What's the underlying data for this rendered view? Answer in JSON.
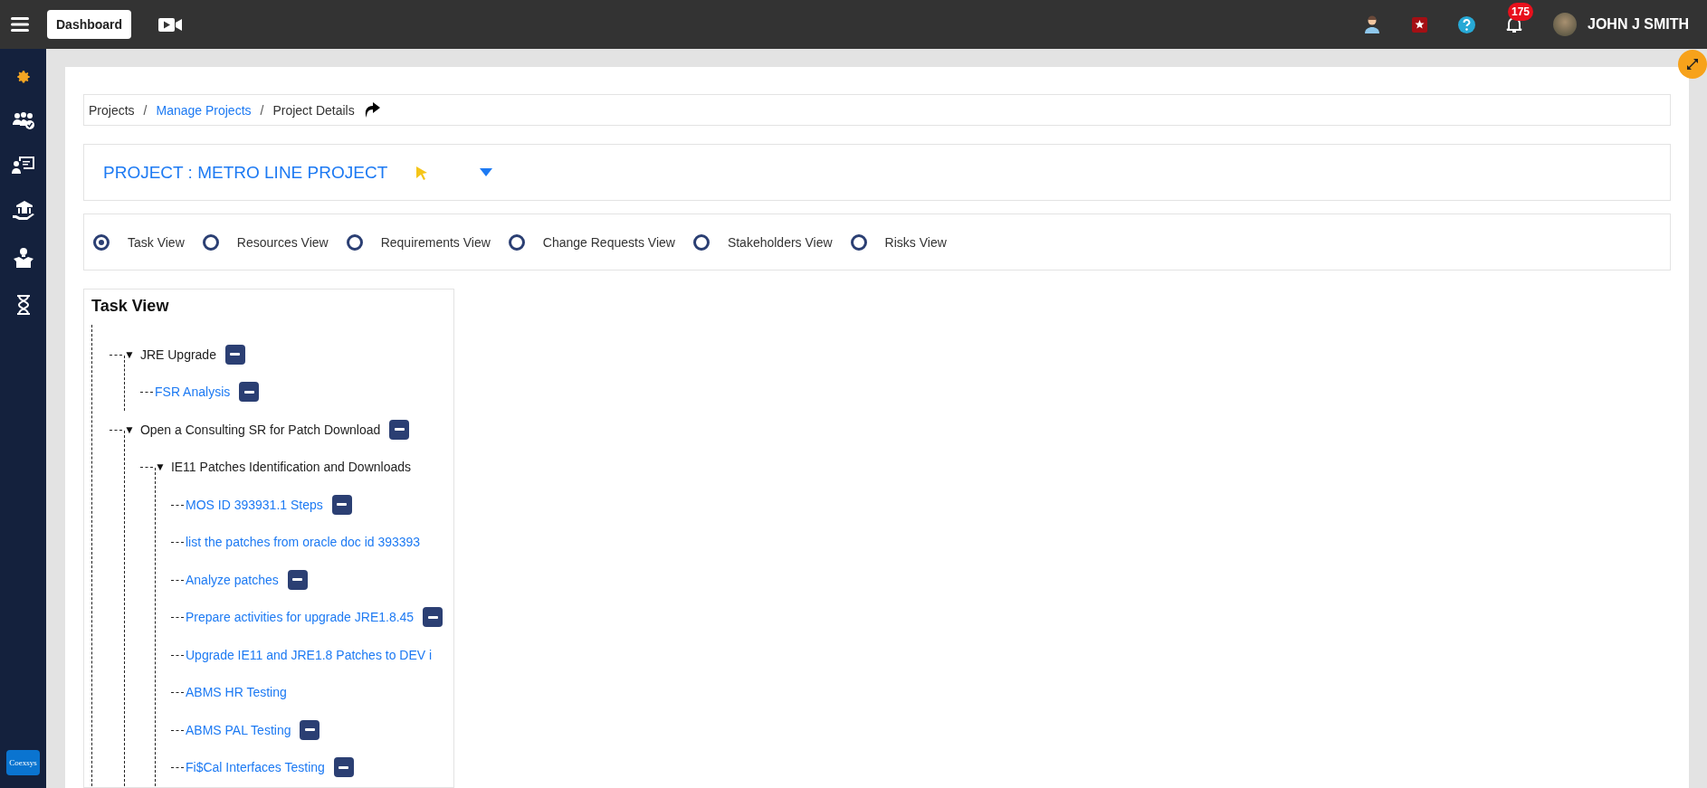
{
  "top_bar": {
    "dashboard_button": "Dashboard",
    "notification_count": "175",
    "user_name": "JOHN J SMITH"
  },
  "sidebar": {
    "items": [
      {
        "selected": true
      },
      {
        "selected": false
      },
      {
        "selected": false
      },
      {
        "selected": false
      },
      {
        "selected": false
      },
      {
        "selected": false
      }
    ],
    "logo": "Coexsys"
  },
  "breadcrumb": [
    {
      "label": "Projects",
      "link": false
    },
    {
      "separator": "/",
      "label": "Manage Projects",
      "link": true
    },
    {
      "separator": "/",
      "label": "Project Details",
      "link": false
    }
  ],
  "project": {
    "title": "PROJECT : METRO LINE PROJECT"
  },
  "views": [
    {
      "label": "Task View",
      "selected": true
    },
    {
      "label": "Resources View",
      "selected": false
    },
    {
      "label": "Requirements View",
      "selected": false
    },
    {
      "label": "Change Requests View",
      "selected": false
    },
    {
      "label": "Stakeholders View",
      "selected": false
    },
    {
      "label": "Risks View",
      "selected": false
    }
  ],
  "task_view": {
    "title": "Task View",
    "tree": [
      {
        "caret": "▼",
        "label": "JRE Upgrade",
        "link": false,
        "expanded": true,
        "removable": true,
        "children": [
          {
            "label": "FSR Analysis",
            "link": true,
            "removable": true
          }
        ]
      },
      {
        "caret": "▼",
        "label": "Open a Consulting SR for Patch Download",
        "link": false,
        "expanded": true,
        "removable": true,
        "children": [
          {
            "caret": "▼",
            "label": "IE11 Patches Identification and Downloads",
            "link": false,
            "expanded": true,
            "removable": false,
            "children": [
              {
                "label": "MOS ID 393931.1 Steps",
                "link": true,
                "removable": true
              },
              {
                "label": "list the patches from oracle doc id 393393",
                "link": true,
                "removable": false
              },
              {
                "label": "Analyze patches",
                "link": true,
                "removable": true
              },
              {
                "label": "Prepare activities for upgrade JRE1.8.45",
                "link": true,
                "removable": true
              },
              {
                "label": "Upgrade IE11 and JRE1.8 Patches to DEV i",
                "link": true,
                "removable": false
              },
              {
                "label": "ABMS HR Testing",
                "link": true,
                "removable": false
              },
              {
                "label": "ABMS PAL Testing",
                "link": true,
                "removable": true
              },
              {
                "label": "Fi$Cal Interfaces Testing",
                "link": true,
                "removable": true
              }
            ]
          }
        ]
      }
    ]
  }
}
